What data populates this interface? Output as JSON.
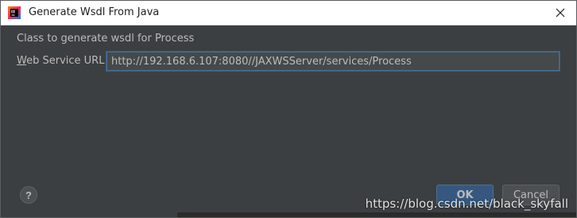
{
  "window": {
    "title": "Generate Wsdl From Java"
  },
  "form": {
    "heading": "Class to generate wsdl for Process",
    "url_label_mnemonic": "W",
    "url_label_rest": "eb Service URL:",
    "url_value": "http://192.168.6.107:8080//JAXWSServer/services/Process"
  },
  "buttons": {
    "help_label": "?",
    "ok_label": "OK",
    "cancel_label": "Cancel"
  },
  "watermark": "https://blog.csdn.net/black_skyfall",
  "icons": {
    "app": "intellij-idea-icon",
    "close": "close-icon",
    "help": "help-icon"
  },
  "colors": {
    "dialog_bg": "#3c3f41",
    "input_bg": "#45494a",
    "focus_border": "#466d94",
    "ok_bg": "#365880",
    "text": "#bbbbbb"
  }
}
